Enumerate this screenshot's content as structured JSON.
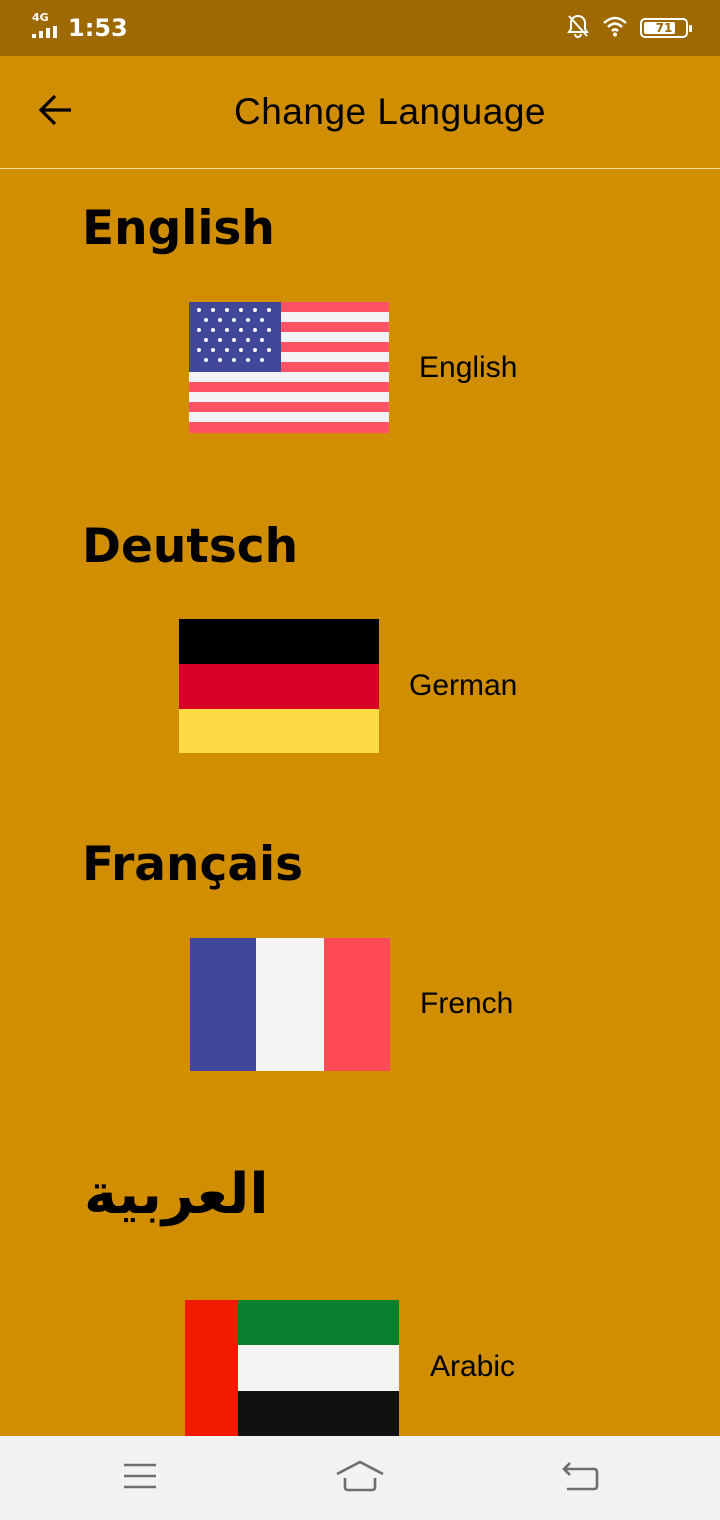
{
  "status_bar": {
    "network": "4G",
    "time": "1:53",
    "battery_level": "71",
    "icons": [
      "signal-icon",
      "notifications-muted-icon",
      "wifi-icon",
      "battery-icon"
    ]
  },
  "app_bar": {
    "title": "Change Language",
    "back_icon": "back-arrow-icon"
  },
  "languages": [
    {
      "heading": "English",
      "name": "English",
      "flag": "us-flag-icon"
    },
    {
      "heading": "Deutsch",
      "name": "German",
      "flag": "germany-flag-icon"
    },
    {
      "heading": "Français",
      "name": "French",
      "flag": "france-flag-icon"
    },
    {
      "heading": "العربية",
      "name": "Arabic",
      "flag": "uae-flag-icon"
    }
  ],
  "nav_bar": {
    "icons": [
      "menu-icon",
      "home-icon",
      "back-icon"
    ]
  },
  "colors": {
    "background": "#D08E00",
    "status_bar": "#9E6A00",
    "nav_bar": "#F2F2F2"
  }
}
